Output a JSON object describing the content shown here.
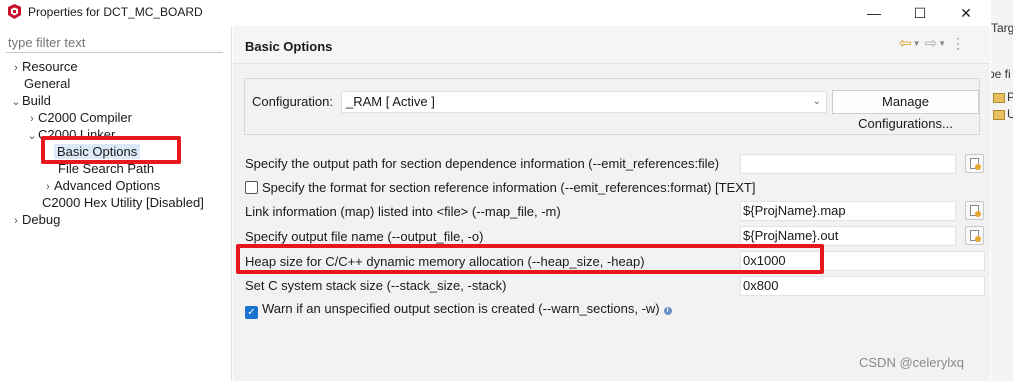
{
  "window": {
    "title": "Properties for DCT_MC_BOARD",
    "minimize_glyph": "—",
    "maximize_glyph": "☐",
    "close_glyph": "✕"
  },
  "filter": {
    "placeholder": "type filter text"
  },
  "tree": {
    "resource": "Resource",
    "general": "General",
    "build": "Build",
    "compiler": "C2000 Compiler",
    "linker": "C2000 Linker",
    "basic_options": "Basic Options",
    "file_search_path": "File Search Path",
    "advanced_options": "Advanced Options",
    "hex_utility": "C2000 Hex Utility  [Disabled]",
    "debug": "Debug"
  },
  "page": {
    "title": "Basic Options"
  },
  "configuration": {
    "label": "Configuration:",
    "value": "_RAM  [ Active ]",
    "manage_button": "Manage Configurations..."
  },
  "options": {
    "emit_references_file": {
      "label": "Specify the output path for section dependence information (--emit_references:file)",
      "value": ""
    },
    "emit_references_format": {
      "label": "Specify the format for section reference information (--emit_references:format) [TEXT]",
      "checked": false
    },
    "map_file": {
      "label": "Link information (map) listed into <file> (--map_file, -m)",
      "value": "${ProjName}.map"
    },
    "output_file": {
      "label": "Specify output file name (--output_file, -o)",
      "value": "${ProjName}.out"
    },
    "heap_size": {
      "label": "Heap size for C/C++ dynamic memory allocation (--heap_size, -heap)",
      "value": "0x1000"
    },
    "stack_size": {
      "label": "Set C system stack size (--stack_size, -stack)",
      "value": "0x800"
    },
    "warn_sections": {
      "label": "Warn if an unspecified output section is created (--warn_sections, -w)",
      "checked": true
    }
  },
  "background_window": {
    "text1": "Targ",
    "text2": "pe fi",
    "text3": "P",
    "text4": "U"
  },
  "watermark": "CSDN @celerylxq",
  "icons": {
    "app": "ti-logo-icon",
    "back": "back-arrow-icon",
    "forward": "forward-arrow-icon",
    "menu": "kebab-menu-icon",
    "browse": "browse-file-icon",
    "info": "info-icon"
  },
  "colors": {
    "highlight_box": "#e8161d",
    "selection": "#dbe9f8",
    "checkbox_checked": "#1a73d0",
    "nav_back": "#d89a1c"
  }
}
